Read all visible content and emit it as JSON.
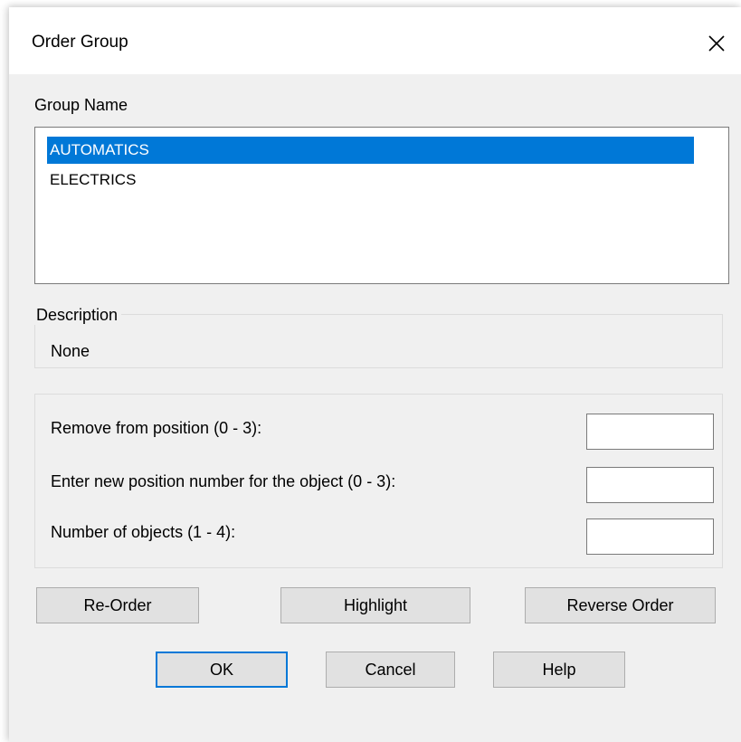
{
  "window": {
    "title": "Order Group",
    "close_icon": "close-icon"
  },
  "group_list": {
    "header": "Group  Name",
    "items": [
      {
        "label": "AUTOMATICS",
        "selected": true
      },
      {
        "label": "ELECTRICS",
        "selected": false
      }
    ]
  },
  "description": {
    "legend": "Description",
    "value": "None"
  },
  "positions": {
    "remove_label": "Remove from position (0 - 3):",
    "remove_value": "",
    "new_position_label": "Enter new position number for the object (0 - 3):",
    "new_position_value": "",
    "count_label": "Number of objects (1 - 4):",
    "count_value": ""
  },
  "actions": {
    "reorder": "Re-Order",
    "highlight": "Highlight",
    "reverse": "Reverse Order"
  },
  "footer": {
    "ok": "OK",
    "cancel": "Cancel",
    "help": "Help"
  },
  "colors": {
    "selection": "#0078d7",
    "dialog_bg": "#f0f0f0",
    "button_bg": "#e1e1e1"
  }
}
